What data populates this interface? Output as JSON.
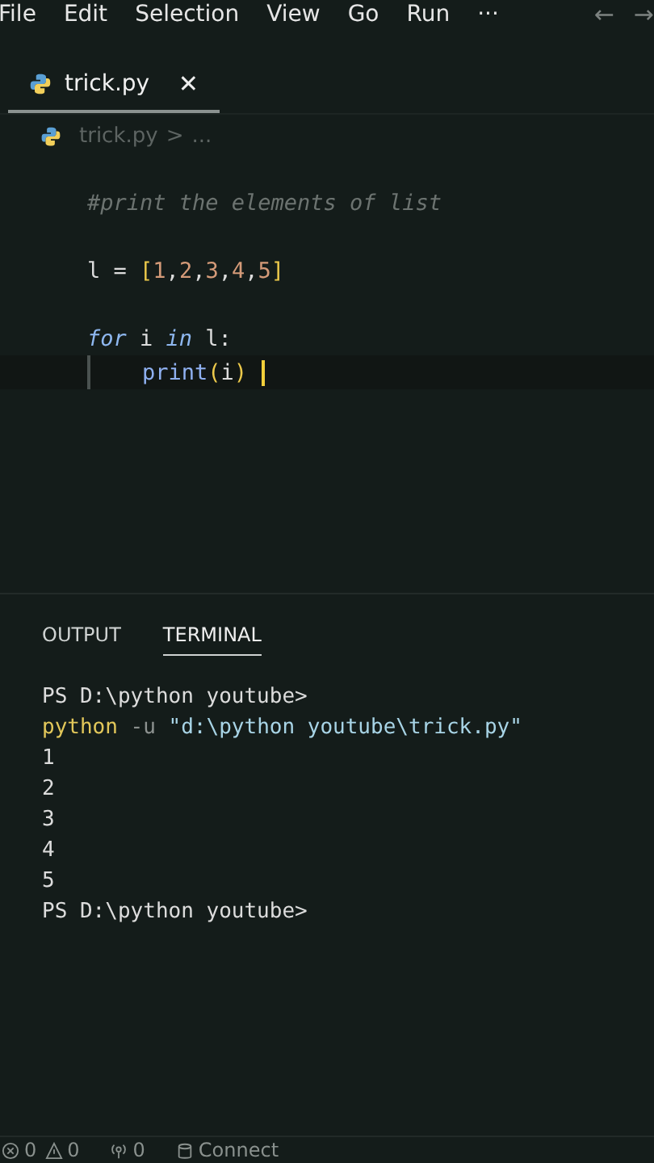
{
  "menu": [
    "File",
    "Edit",
    "Selection",
    "View",
    "Go",
    "Run",
    "···"
  ],
  "nav": [
    "←",
    "→"
  ],
  "editor_tab": {
    "label": "trick.py",
    "close": "✕",
    "selected": true
  },
  "breadcrumb": {
    "file": "trick.py",
    "separator": ">",
    "rest": "..."
  },
  "code_lines": [
    {
      "kind": "code",
      "current": false,
      "tokens": [
        {
          "text": "#print the elements of list",
          "kind": "comment"
        }
      ]
    },
    {
      "kind": "blank",
      "current": false
    },
    {
      "kind": "code",
      "current": false,
      "tokens": [
        {
          "text": "l = ",
          "kind": "plain"
        },
        {
          "text": "[",
          "kind": "bracket"
        },
        {
          "text": "1",
          "kind": "number"
        },
        {
          "text": ",",
          "kind": "plain"
        },
        {
          "text": "2",
          "kind": "number"
        },
        {
          "text": ",",
          "kind": "plain"
        },
        {
          "text": "3",
          "kind": "number"
        },
        {
          "text": ",",
          "kind": "plain"
        },
        {
          "text": "4",
          "kind": "number"
        },
        {
          "text": ",",
          "kind": "plain"
        },
        {
          "text": "5",
          "kind": "number"
        },
        {
          "text": "]",
          "kind": "bracket"
        }
      ]
    },
    {
      "kind": "blank",
      "current": false
    },
    {
      "kind": "code",
      "current": false,
      "tokens": [
        {
          "text": "for",
          "kind": "keyword"
        },
        {
          "text": " i ",
          "kind": "plain"
        },
        {
          "text": "in",
          "kind": "keyword"
        },
        {
          "text": " l:",
          "kind": "plain"
        }
      ],
      "children": [
        {
          "kind": "code",
          "current": true,
          "tokens": [
            {
              "text": "print",
              "kind": "function"
            },
            {
              "text": "(",
              "kind": "bracket"
            },
            {
              "text": "i",
              "kind": "plain"
            },
            {
              "text": ")",
              "kind": "bracket"
            }
          ]
        }
      ]
    }
  ],
  "panel_tabs": [
    {
      "label": "OUTPUT",
      "selected": false
    },
    {
      "label": "TERMINAL",
      "selected": true
    }
  ],
  "terminal_lines": [
    {
      "tokens": [
        {
          "text": "PS D:\\python youtube>",
          "kind": "plain"
        }
      ]
    },
    {
      "tokens": [
        {
          "text": "python",
          "kind": "command"
        },
        {
          "text": " -u ",
          "kind": "dim"
        },
        {
          "text": "\"d:\\python youtube\\trick.py\"",
          "kind": "string"
        }
      ]
    },
    {
      "tokens": [
        {
          "text": "1",
          "kind": "plain"
        }
      ]
    },
    {
      "tokens": [
        {
          "text": "2",
          "kind": "plain"
        }
      ]
    },
    {
      "tokens": [
        {
          "text": "3",
          "kind": "plain"
        }
      ]
    },
    {
      "tokens": [
        {
          "text": "4",
          "kind": "plain"
        }
      ]
    },
    {
      "tokens": [
        {
          "text": "5",
          "kind": "plain"
        }
      ]
    },
    {
      "tokens": [
        {
          "text": "PS D:\\python youtube>",
          "kind": "plain"
        }
      ]
    }
  ],
  "status_bar": {
    "errors": "0",
    "warnings": "0",
    "ports": "0",
    "remote": "Connect"
  }
}
